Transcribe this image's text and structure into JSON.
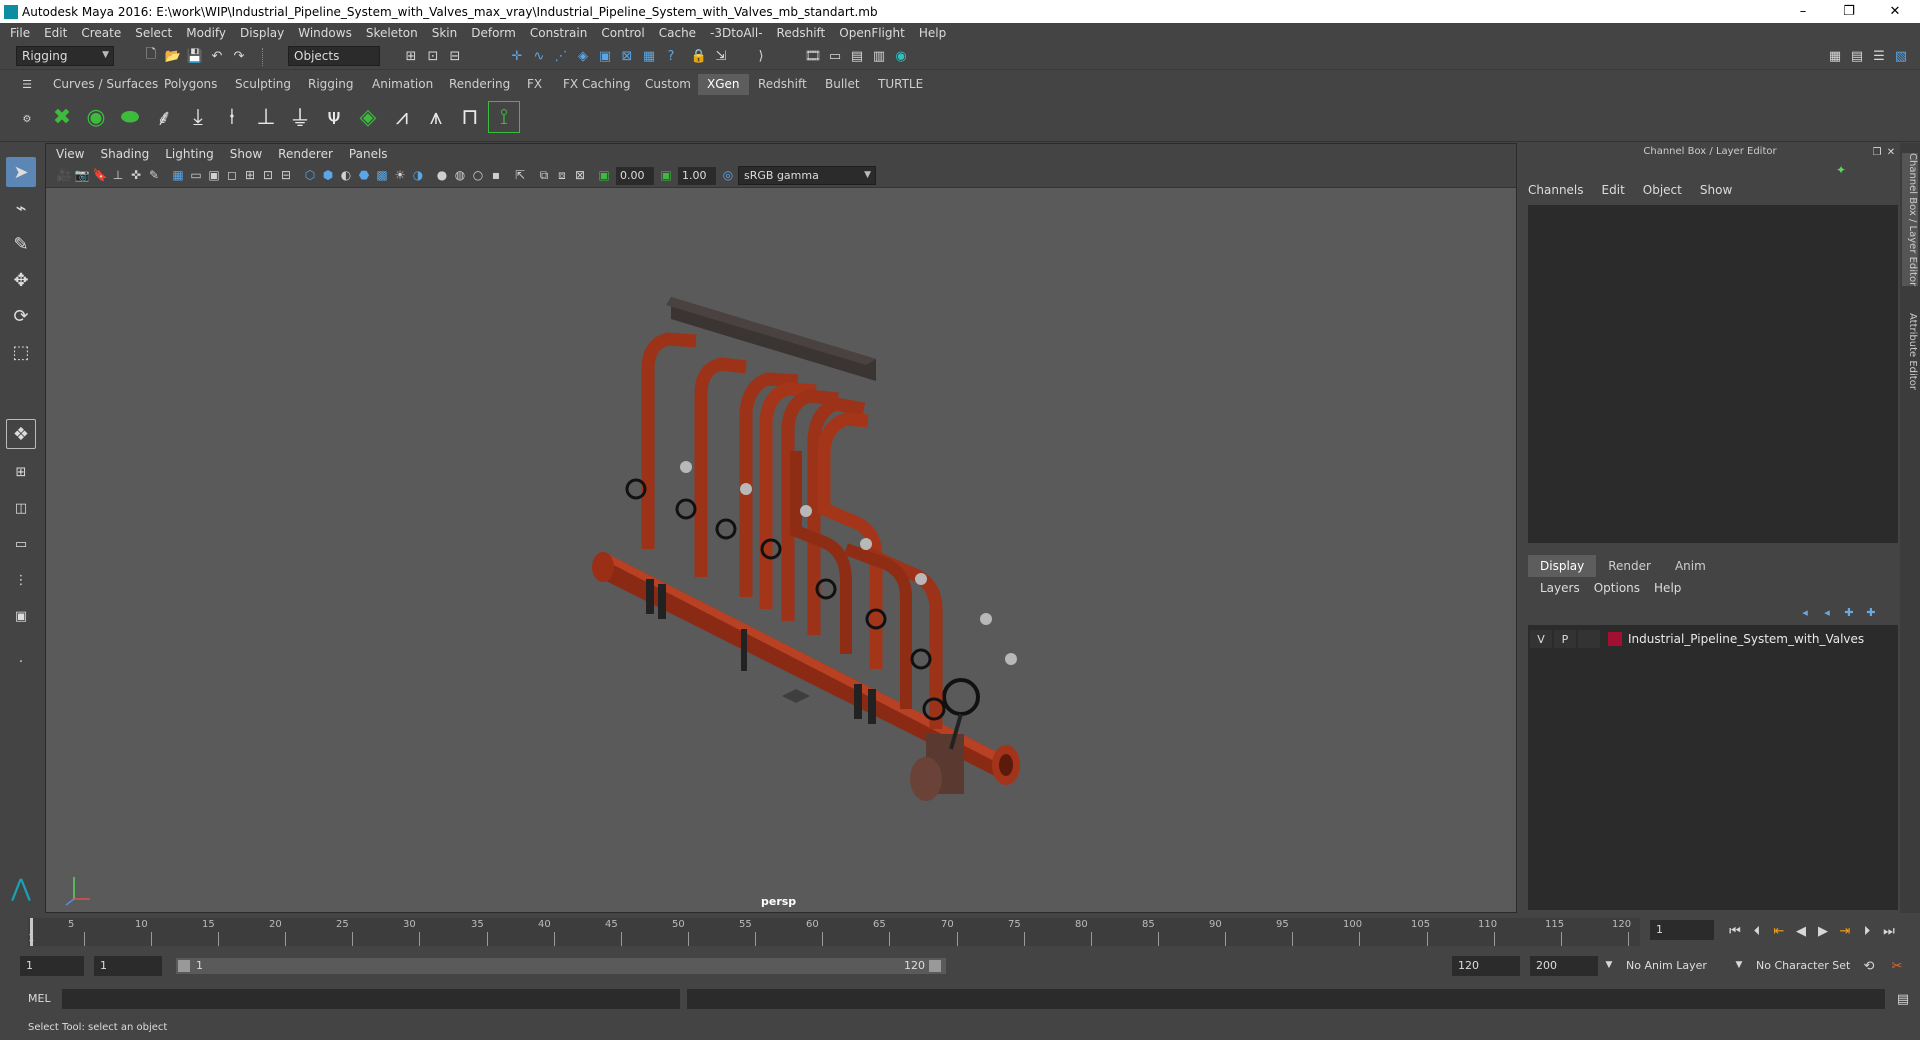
{
  "window": {
    "title": "Autodesk Maya 2016: E:\\work\\WIP\\Industrial_Pipeline_System_with_Valves_max_vray\\Industrial_Pipeline_System_with_Valves_mb_standart.mb",
    "minimize": "–",
    "restore": "❐",
    "close": "✕"
  },
  "menubar": [
    "File",
    "Edit",
    "Create",
    "Select",
    "Modify",
    "Display",
    "Windows",
    "Skeleton",
    "Skin",
    "Deform",
    "Constrain",
    "Control",
    "Cache",
    "-3DtoAll-",
    "Redshift",
    "OpenFlight",
    "Help"
  ],
  "statusline": {
    "menuset": "Rigging",
    "selection_mode": "Objects"
  },
  "shelf_tabs": [
    "Curves / Surfaces",
    "Polygons",
    "Sculpting",
    "Rigging",
    "Animation",
    "Rendering",
    "FX",
    "FX Caching",
    "Custom",
    "XGen",
    "Redshift",
    "Bullet",
    "TURTLE"
  ],
  "shelf_active": "XGen",
  "panel": {
    "menus": [
      "View",
      "Shading",
      "Lighting",
      "Show",
      "Renderer",
      "Panels"
    ],
    "exposure": "0.00",
    "gamma": "1.00",
    "color_space": "sRGB gamma",
    "camera_label": "persp"
  },
  "right_panel": {
    "title": "Channel Box / Layer Editor",
    "channel_menu": [
      "Channels",
      "Edit",
      "Object",
      "Show"
    ],
    "layer_tabs": [
      "Display",
      "Render",
      "Anim"
    ],
    "layer_active": "Display",
    "layer_menu": [
      "Layers",
      "Options",
      "Help"
    ],
    "layer": {
      "visible": "V",
      "playback": "P",
      "color": "#a01030",
      "name": "Industrial_Pipeline_System_with_Valves"
    }
  },
  "side_tabs": [
    "Channel Box / Layer Editor",
    "Attribute Editor"
  ],
  "timeslider": {
    "current_frame": "1",
    "ticks": [
      "5",
      "10",
      "15",
      "20",
      "25",
      "30",
      "35",
      "40",
      "45",
      "50",
      "55",
      "60",
      "65",
      "70",
      "75",
      "80",
      "85",
      "90",
      "95",
      "100",
      "105",
      "110",
      "115",
      "120"
    ],
    "first_label": "1",
    "current_field": "1"
  },
  "range": {
    "start": "1",
    "anim_start": "1",
    "slider_start": "1",
    "slider_end": "120",
    "anim_end": "120",
    "end": "200",
    "anim_layer": "No Anim Layer",
    "character_set": "No Character Set"
  },
  "command_line": {
    "label": "MEL"
  },
  "help_line": "Select Tool: select an object"
}
